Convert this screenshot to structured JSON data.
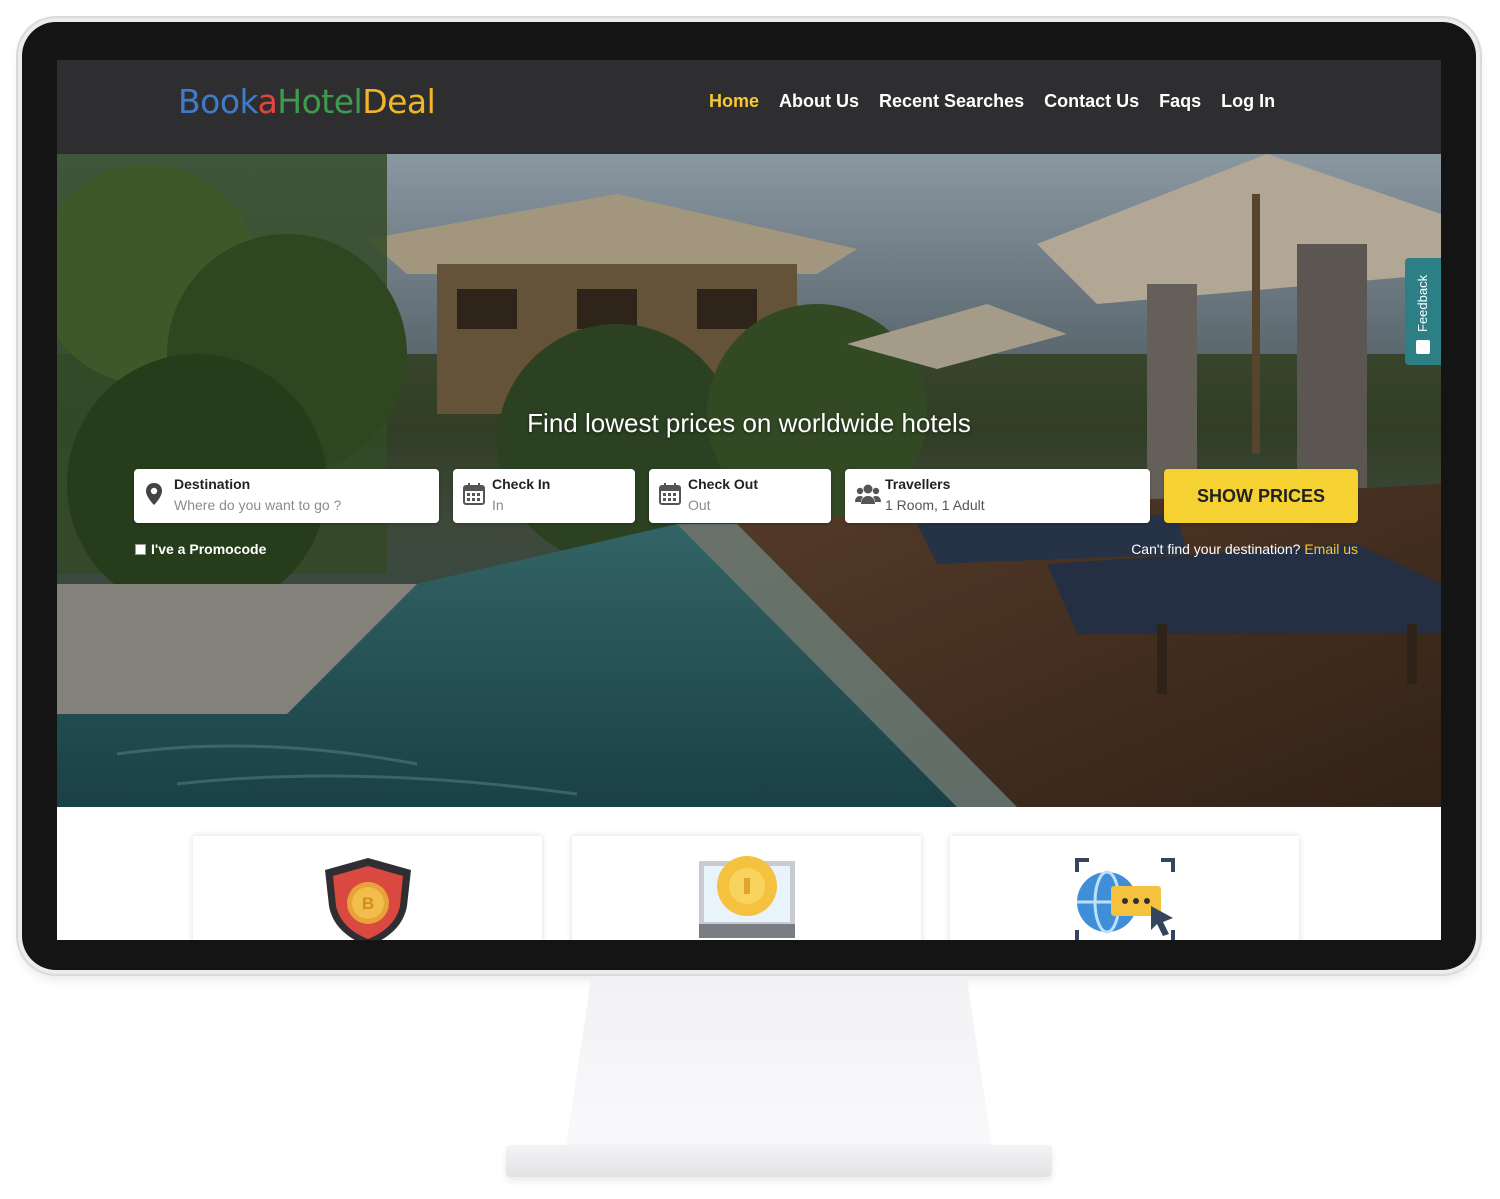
{
  "header": {
    "logo": {
      "part1": "Booka",
      "part2": "a",
      "part3": "Hotel",
      "part4": "Deal"
    },
    "nav": [
      {
        "label": "Home",
        "active": true
      },
      {
        "label": "About Us"
      },
      {
        "label": "Recent Searches"
      },
      {
        "label": "Contact Us"
      },
      {
        "label": "Faqs"
      },
      {
        "label": "Log In"
      }
    ]
  },
  "hero": {
    "title": "Find lowest prices on worldwide hotels",
    "destination": {
      "label": "Destination",
      "placeholder": "Where do you want to go ?",
      "icon": "map-pin-icon"
    },
    "checkin": {
      "label": "Check In",
      "value": "In",
      "icon": "calendar-icon"
    },
    "checkout": {
      "label": "Check Out",
      "value": "Out",
      "icon": "calendar-icon"
    },
    "travellers": {
      "label": "Travellers",
      "value": "1 Room, 1 Adult",
      "icon": "users-icon"
    },
    "show_prices": "SHOW PRICES",
    "promo_label": "I've a Promocode",
    "cant_find": "Can't find your destination?",
    "email_link": "Email us",
    "feedback": "Feedback"
  },
  "features": {
    "icons": [
      "shield-coin-icon",
      "monitor-coin-icon",
      "globe-chat-icon"
    ]
  },
  "colors": {
    "header_bg": "#2e2e31",
    "accent_yellow": "#f5d131",
    "nav_active": "#f6c832",
    "feedback_teal": "#2d7f86"
  }
}
